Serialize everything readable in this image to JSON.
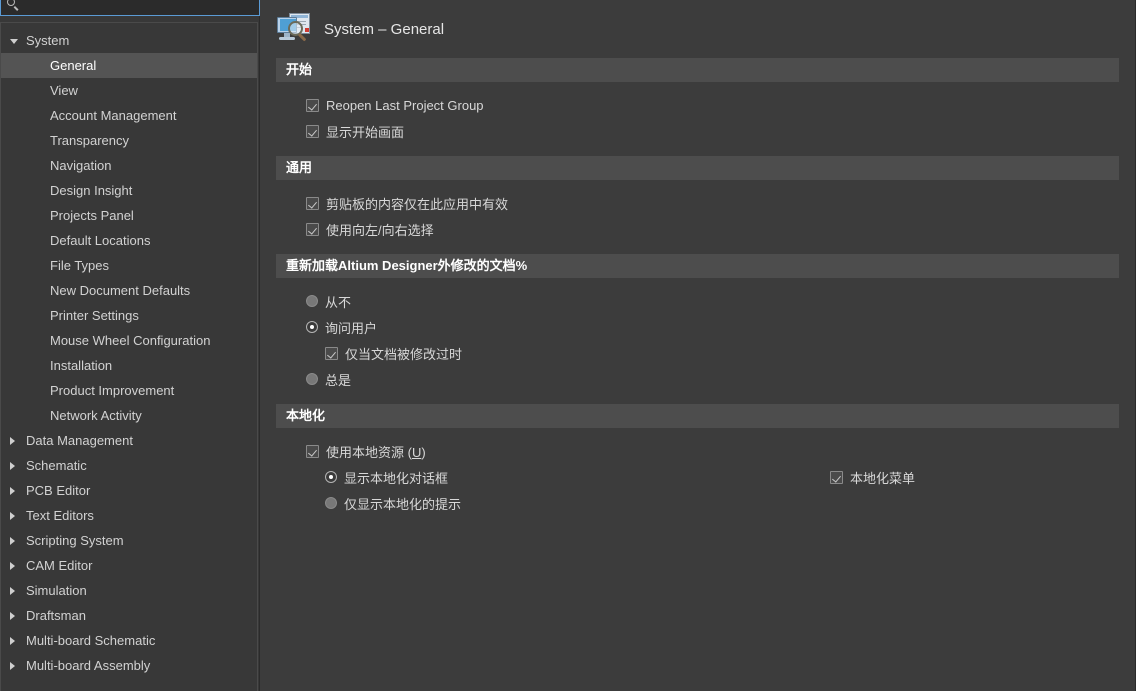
{
  "search": {
    "placeholder": "",
    "value": "",
    "icon": "search-icon"
  },
  "sidebar": {
    "items": [
      {
        "label": "System",
        "level": 0,
        "state": "expanded",
        "selected": false
      },
      {
        "label": "General",
        "level": 1,
        "state": "leaf",
        "selected": true
      },
      {
        "label": "View",
        "level": 1,
        "state": "leaf",
        "selected": false
      },
      {
        "label": "Account Management",
        "level": 1,
        "state": "leaf",
        "selected": false
      },
      {
        "label": "Transparency",
        "level": 1,
        "state": "leaf",
        "selected": false
      },
      {
        "label": "Navigation",
        "level": 1,
        "state": "leaf",
        "selected": false
      },
      {
        "label": "Design Insight",
        "level": 1,
        "state": "leaf",
        "selected": false
      },
      {
        "label": "Projects Panel",
        "level": 1,
        "state": "leaf",
        "selected": false
      },
      {
        "label": "Default Locations",
        "level": 1,
        "state": "leaf",
        "selected": false
      },
      {
        "label": "File Types",
        "level": 1,
        "state": "leaf",
        "selected": false
      },
      {
        "label": "New Document Defaults",
        "level": 1,
        "state": "leaf",
        "selected": false
      },
      {
        "label": "Printer Settings",
        "level": 1,
        "state": "leaf",
        "selected": false
      },
      {
        "label": "Mouse Wheel Configuration",
        "level": 1,
        "state": "leaf",
        "selected": false
      },
      {
        "label": "Installation",
        "level": 1,
        "state": "leaf",
        "selected": false
      },
      {
        "label": "Product Improvement",
        "level": 1,
        "state": "leaf",
        "selected": false
      },
      {
        "label": "Network Activity",
        "level": 1,
        "state": "leaf",
        "selected": false
      },
      {
        "label": "Data Management",
        "level": 0,
        "state": "collapsed",
        "selected": false
      },
      {
        "label": "Schematic",
        "level": 0,
        "state": "collapsed",
        "selected": false
      },
      {
        "label": "PCB Editor",
        "level": 0,
        "state": "collapsed",
        "selected": false
      },
      {
        "label": "Text Editors",
        "level": 0,
        "state": "collapsed",
        "selected": false
      },
      {
        "label": "Scripting System",
        "level": 0,
        "state": "collapsed",
        "selected": false
      },
      {
        "label": "CAM Editor",
        "level": 0,
        "state": "collapsed",
        "selected": false
      },
      {
        "label": "Simulation",
        "level": 0,
        "state": "collapsed",
        "selected": false
      },
      {
        "label": "Draftsman",
        "level": 0,
        "state": "collapsed",
        "selected": false
      },
      {
        "label": "Multi-board Schematic",
        "level": 0,
        "state": "collapsed",
        "selected": false
      },
      {
        "label": "Multi-board Assembly",
        "level": 0,
        "state": "collapsed",
        "selected": false
      }
    ]
  },
  "header": {
    "title": "System – General",
    "icon": "system-general-icon"
  },
  "sections": {
    "startup": {
      "title": "开始",
      "options": [
        {
          "label": "Reopen Last Project Group",
          "type": "checkbox",
          "checked": true
        },
        {
          "label": "显示开始画面",
          "type": "checkbox",
          "checked": true
        }
      ]
    },
    "general": {
      "title": "通用",
      "options": [
        {
          "label": "剪贴板的内容仅在此应用中有效",
          "type": "checkbox",
          "checked": true
        },
        {
          "label": "使用向左/向右选择",
          "type": "checkbox",
          "checked": true
        }
      ]
    },
    "reload": {
      "title": "重新加载Altium Designer外修改的文档%",
      "options": [
        {
          "label": "从不",
          "type": "radio",
          "checked": false
        },
        {
          "label": "询问用户",
          "type": "radio",
          "checked": true
        },
        {
          "label": "仅当文档被修改过时",
          "type": "checkbox",
          "checked": true
        },
        {
          "label": "总是",
          "type": "radio",
          "checked": false
        }
      ]
    },
    "localization": {
      "title": "本地化",
      "use_local_resources": {
        "label_text": "使用本地资源 (",
        "label_accel": "U",
        "label_suffix": ")",
        "type": "checkbox",
        "checked": true
      },
      "options": [
        {
          "label": "显示本地化对话框",
          "type": "radio",
          "checked": true
        },
        {
          "label": "仅显示本地化的提示",
          "type": "radio",
          "checked": false
        }
      ],
      "localized_menu": {
        "label": "本地化菜单",
        "type": "checkbox",
        "checked": true
      }
    }
  },
  "colors": {
    "panel_bg": "#3c3c3c",
    "sidebar_bg": "#383838",
    "section_header_bg": "#4d4d4d",
    "selection_bg": "#545454",
    "focus_border": "#5b9bd5",
    "text": "#d4d4d4"
  }
}
